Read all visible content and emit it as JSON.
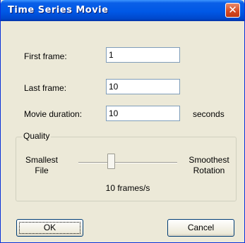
{
  "window": {
    "title": "Time Series Movie",
    "close_glyph": "✕"
  },
  "fields": {
    "first_frame": {
      "label": "First frame:",
      "value": "1"
    },
    "last_frame": {
      "label": "Last frame:",
      "value": "10"
    },
    "movie_duration": {
      "label": "Movie duration:",
      "value": "10",
      "unit": "seconds"
    }
  },
  "quality": {
    "group_label": "Quality",
    "left_label_line1": "Smallest",
    "left_label_line2": "File",
    "right_label_line1": "Smoothest",
    "right_label_line2": "Rotation",
    "value_text": "10 frames/s",
    "slider_fraction": 0.33
  },
  "buttons": {
    "ok": "OK",
    "cancel": "Cancel"
  },
  "colors": {
    "titlebar": "#0058e6",
    "dialog_bg": "#ece9d8",
    "close_button": "#d6481f"
  }
}
